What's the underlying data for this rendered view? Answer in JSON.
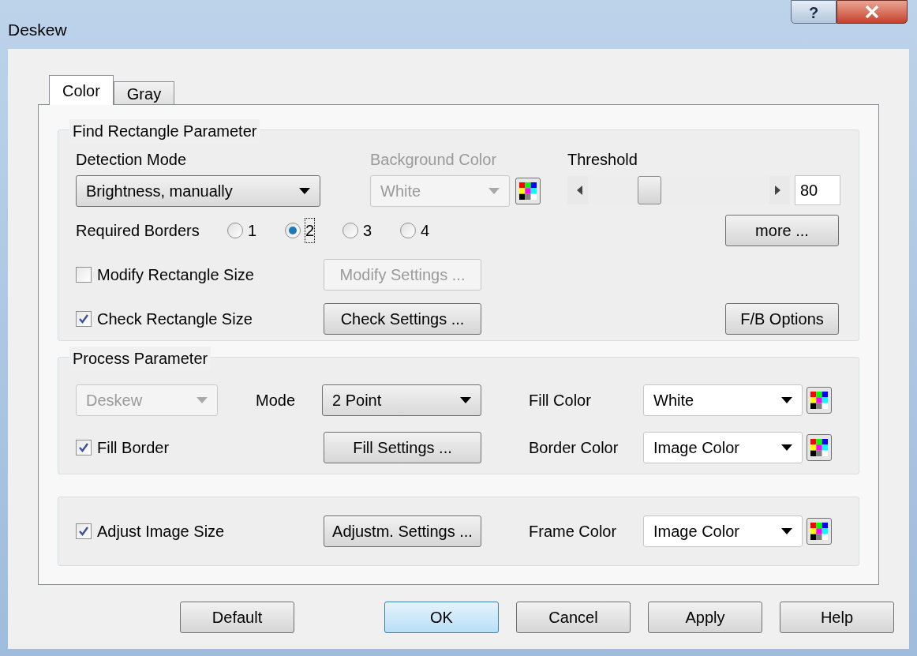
{
  "window": {
    "title": "Deskew",
    "help_button": "?"
  },
  "tabs": [
    {
      "label": "Color",
      "selected": true
    },
    {
      "label": "Gray",
      "selected": false
    }
  ],
  "find_rectangle": {
    "title": "Find Rectangle Parameter",
    "detection_mode": {
      "label": "Detection Mode",
      "value": "Brightness, manually",
      "disabled": false
    },
    "background_color": {
      "label": "Background Color",
      "value": "White",
      "disabled": true
    },
    "threshold": {
      "label": "Threshold",
      "level": 0.34,
      "value": "80"
    },
    "required_borders": {
      "label": "Required Borders",
      "options": [
        {
          "label": "1",
          "selected": false
        },
        {
          "label": "2",
          "selected": true
        },
        {
          "label": "3",
          "selected": false
        },
        {
          "label": "4",
          "selected": false
        }
      ]
    },
    "modify_size": {
      "label": "Modify Rectangle Size",
      "checked": false,
      "button": {
        "label": "Modify Settings ...",
        "disabled": true
      }
    },
    "check_size": {
      "label": "Check Rectangle Size",
      "checked": true,
      "button": {
        "label": "Check Settings ...",
        "disabled": false
      }
    },
    "more_button": "more ...",
    "fb_button": "F/B Options"
  },
  "process": {
    "title": "Process Parameter",
    "type": {
      "value": "Deskew",
      "disabled": true
    },
    "mode": {
      "label": "Mode",
      "value": "2 Point",
      "disabled": false
    },
    "fill_border": {
      "label": "Fill Border",
      "checked": true,
      "button": {
        "label": "Fill Settings ...",
        "disabled": false
      }
    },
    "fill_color": {
      "label": "Fill Color",
      "value": "White"
    },
    "border_color": {
      "label": "Border Color",
      "value": "Image Color"
    }
  },
  "adjust": {
    "adjust_size": {
      "label": "Adjust Image Size",
      "checked": true,
      "button": {
        "label": "Adjustm. Settings ...",
        "disabled": false
      }
    },
    "frame_color": {
      "label": "Frame Color",
      "value": "Image Color"
    }
  },
  "buttons": [
    {
      "label": "Default",
      "default": false
    },
    {
      "label": "OK",
      "default": true
    },
    {
      "label": "Cancel",
      "default": false
    },
    {
      "label": "Apply",
      "default": false
    },
    {
      "label": "Help",
      "default": false
    }
  ]
}
